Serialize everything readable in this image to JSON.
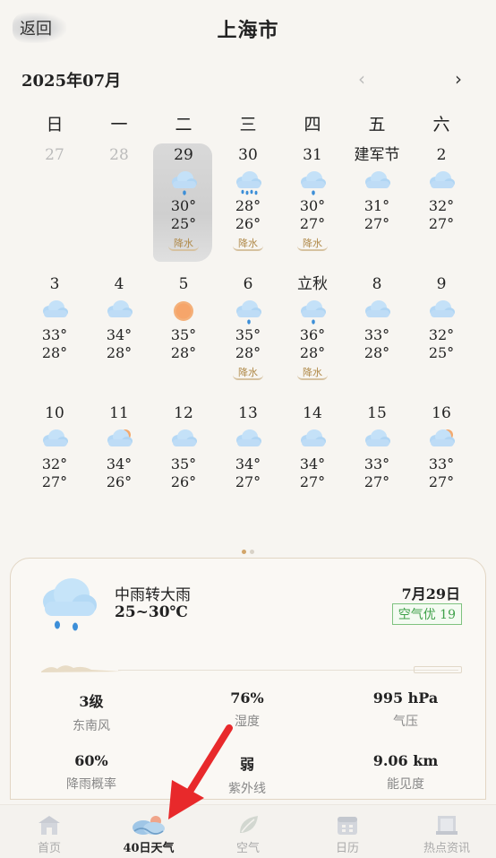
{
  "header": {
    "back_label": "返回",
    "title": "上海市"
  },
  "month": {
    "label": "2025年07月",
    "prev_icon": "‹",
    "next_icon": "›"
  },
  "weekdays": [
    "日",
    "一",
    "二",
    "三",
    "四",
    "五",
    "六"
  ],
  "weeks": [
    [
      {
        "label": "27",
        "muted": true
      },
      {
        "label": "28",
        "muted": true
      },
      {
        "label": "29",
        "icon": "rain",
        "high": "30°",
        "low": "25°",
        "rain_tag": "降水",
        "selected": true
      },
      {
        "label": "30",
        "icon": "heavy-rain",
        "high": "28°",
        "low": "26°",
        "rain_tag": "降水"
      },
      {
        "label": "31",
        "icon": "rain",
        "high": "30°",
        "low": "27°",
        "rain_tag": "降水"
      },
      {
        "label": "建军节",
        "icon": "cloud",
        "high": "31°",
        "low": "27°"
      },
      {
        "label": "2",
        "icon": "cloud",
        "high": "32°",
        "low": "27°"
      }
    ],
    [
      {
        "label": "3",
        "icon": "cloud",
        "high": "33°",
        "low": "28°"
      },
      {
        "label": "4",
        "icon": "cloud",
        "high": "34°",
        "low": "28°"
      },
      {
        "label": "5",
        "icon": "sun",
        "high": "35°",
        "low": "28°"
      },
      {
        "label": "6",
        "icon": "rain",
        "high": "35°",
        "low": "28°",
        "rain_tag": "降水"
      },
      {
        "label": "立秋",
        "icon": "rain",
        "high": "36°",
        "low": "28°",
        "rain_tag": "降水"
      },
      {
        "label": "8",
        "icon": "cloud",
        "high": "33°",
        "low": "28°"
      },
      {
        "label": "9",
        "icon": "cloud",
        "high": "32°",
        "low": "25°"
      }
    ],
    [
      {
        "label": "10",
        "icon": "cloud",
        "high": "32°",
        "low": "27°"
      },
      {
        "label": "11",
        "icon": "partly-sunny",
        "high": "34°",
        "low": "26°"
      },
      {
        "label": "12",
        "icon": "cloud",
        "high": "35°",
        "low": "26°"
      },
      {
        "label": "13",
        "icon": "cloud",
        "high": "34°",
        "low": "27°"
      },
      {
        "label": "14",
        "icon": "cloud",
        "high": "34°",
        "low": "27°"
      },
      {
        "label": "15",
        "icon": "cloud",
        "high": "33°",
        "low": "27°"
      },
      {
        "label": "16",
        "icon": "partly-sunny",
        "high": "33°",
        "low": "27°"
      }
    ]
  ],
  "summary": {
    "condition": "中雨转大雨",
    "temp_range": "25~30℃",
    "date": "7月29日",
    "aqi": "空气优 19",
    "icon": "rain-cloud-icon"
  },
  "stats": [
    {
      "value": "3级",
      "label": "东南风"
    },
    {
      "value": "76%",
      "label": "湿度"
    },
    {
      "value": "995 hPa",
      "label": "气压"
    },
    {
      "value": "60%",
      "label": "降雨概率"
    },
    {
      "value": "弱",
      "label": "紫外线"
    },
    {
      "value": "9.06 km",
      "label": "能见度"
    }
  ],
  "tabs": [
    {
      "label": "首页",
      "icon": "home-icon"
    },
    {
      "label": "40日天气",
      "icon": "cloud-tab-icon",
      "active": true
    },
    {
      "label": "空气",
      "icon": "leaf-icon"
    },
    {
      "label": "日历",
      "icon": "calendar-icon"
    },
    {
      "label": "热点资讯",
      "icon": "news-icon"
    }
  ],
  "colors": {
    "accent": "#d2a56a",
    "aqi_green": "#3fa14a",
    "arrow_red": "#e8292b",
    "cloud_blue": "#a9d3f5"
  }
}
